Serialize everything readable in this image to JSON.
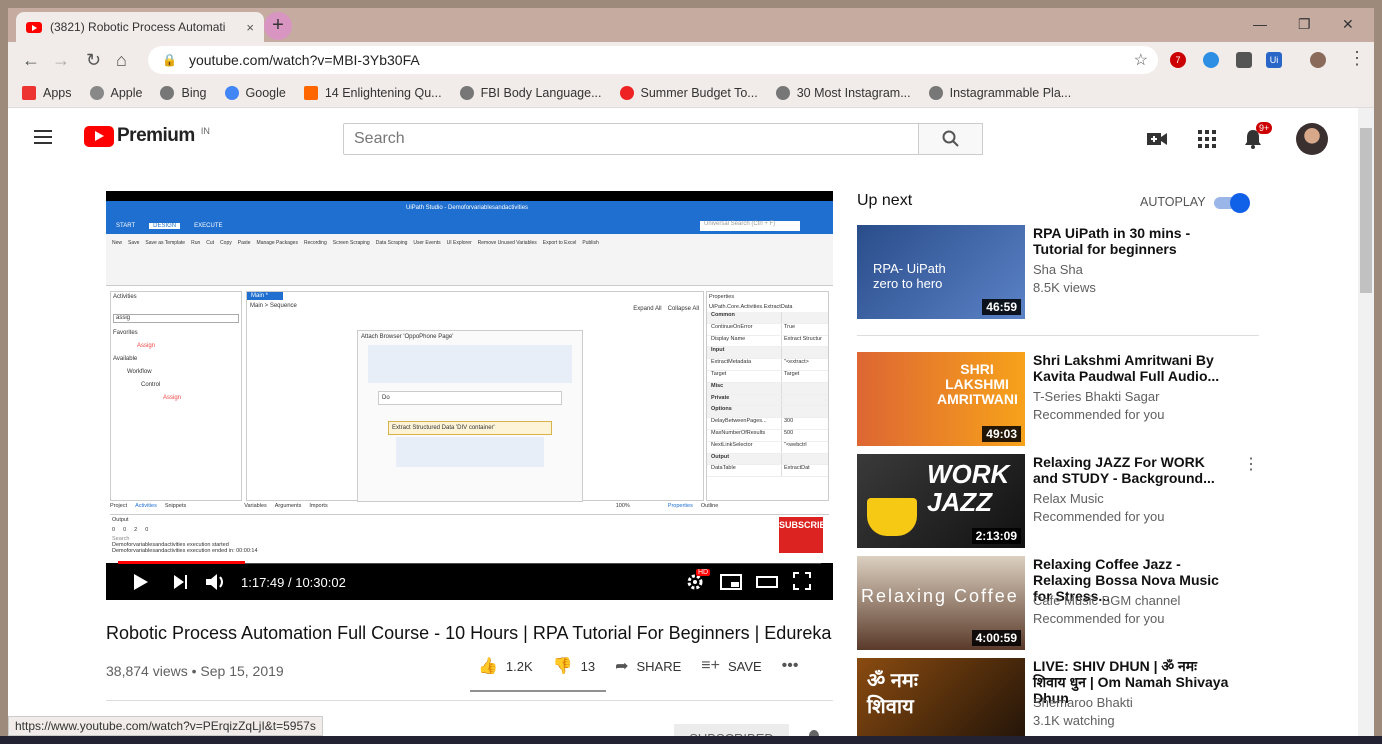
{
  "browser": {
    "tab_title": "(3821) Robotic Process Automati",
    "tab_close": "×",
    "new_tab": "+",
    "url": "youtube.com/watch?v=MBI-3Yb30FA",
    "bookmarks": [
      "Apps",
      "Apple",
      "Bing",
      "Google",
      "14 Enlightening Qu...",
      "FBI Body Language...",
      "Summer Budget To...",
      "30 Most Instagram...",
      "Instagrammable Pla..."
    ],
    "status_url": "https://www.youtube.com/watch?v=PErqizZqLjI&t=5957s",
    "ext_abp_count": "7"
  },
  "youtube": {
    "logo": "Premium",
    "country": "IN",
    "search_placeholder": "Search",
    "notification_count": "9+"
  },
  "video": {
    "time": "1:17:49 / 10:30:02",
    "title": "Robotic Process Automation Full Course - 10 Hours | RPA Tutorial For Beginners | Edureka",
    "meta": "38,874 views • Sep 15, 2019",
    "likes": "1.2K",
    "dislikes": "13",
    "share": "SHARE",
    "save": "SAVE",
    "subscribe": "SUBSCRIBED",
    "progress_fraction": 0.18,
    "studio": {
      "title": "UiPath Studio - Demoforvariablesandactivities",
      "tabs": [
        "START",
        "DESIGN",
        "EXECUTE"
      ],
      "search": "Universal Search (Ctrl + F)",
      "ribbon": [
        "New",
        "Save",
        "Save as Template",
        "Run",
        "Cut",
        "Copy",
        "Paste",
        "Manage Packages",
        "Recording",
        "Screen Scraping",
        "Data Scraping",
        "User Events",
        "UI Explorer",
        "Remove Unused Variables",
        "Export to Excel",
        "Publish"
      ],
      "activities_panel": "Activities",
      "activities_search": "assig",
      "tree": [
        "Favorites",
        "Assign",
        "Available",
        "Workflow",
        "Control",
        "Assign"
      ],
      "main_tab": "Main *",
      "breadcrumb": "Main > Sequence",
      "expand": "Expand All",
      "collapse": "Collapse All",
      "attach": "Attach Browser 'OppoPhone Page'",
      "do": "Do",
      "extract": "Extract Structured Data 'DIV  container'",
      "properties_title": "Properties",
      "properties_class": "UiPath.Core.Activities.ExtractData",
      "props": [
        {
          "k": "Common",
          "v": ""
        },
        {
          "k": "ContinueOnError",
          "v": "True"
        },
        {
          "k": "Display Name",
          "v": "Extract Structur"
        },
        {
          "k": "Input",
          "v": ""
        },
        {
          "k": "ExtractMetadata",
          "v": "\"<extract>"
        },
        {
          "k": "Target",
          "v": "Target"
        },
        {
          "k": "Misc",
          "v": ""
        },
        {
          "k": "Private",
          "v": ""
        },
        {
          "k": "Options",
          "v": ""
        },
        {
          "k": "DelayBetweenPages...",
          "v": "300"
        },
        {
          "k": "MaxNumberOfResults",
          "v": "500"
        },
        {
          "k": "NextLinkSelector",
          "v": "\"<webctrl"
        },
        {
          "k": "Output",
          "v": ""
        },
        {
          "k": "DataTable",
          "v": "ExtractDat"
        }
      ],
      "bottom_tabs": [
        "Project",
        "Activities",
        "Snippets"
      ],
      "center_tabs": [
        "Variables",
        "Arguments",
        "Imports"
      ],
      "zoom": "100%",
      "right_tabs": [
        "Properties",
        "Outline"
      ],
      "output": "Output",
      "output_counts": [
        "0",
        "0",
        "2",
        "0"
      ],
      "log1": "Demoforvariablesandactivities execution started",
      "log2": "Demoforvariablesandactivities execution ended in: 00:00:14",
      "search_label": "Search",
      "subscribe_badge": "SUBSCRIBE"
    }
  },
  "sidebar": {
    "upnext": "Up next",
    "autoplay": "AUTOPLAY",
    "recs": [
      {
        "title": "RPA UiPath in 30 mins - Tutorial for beginners",
        "channel": "Sha Sha",
        "views": "8.5K views",
        "duration": "46:59",
        "thumb_text": "RPA- UiPath zero to hero"
      },
      {
        "title": "Shri Lakshmi Amritwani By Kavita Paudwal Full Audio...",
        "channel": "T-Series Bhakti Sagar",
        "views": "Recommended for you",
        "duration": "49:03",
        "thumb_text": "SHRI LAKSHMI AMRITWANI"
      },
      {
        "title": "Relaxing JAZZ For WORK and STUDY - Background...",
        "channel": "Relax Music",
        "views": "Recommended for you",
        "duration": "2:13:09",
        "thumb_text": "WORK JAZZ"
      },
      {
        "title": "Relaxing Coffee Jazz - Relaxing Bossa Nova Music for Stress...",
        "channel": "Cafe Music BGM channel",
        "views": "Recommended for you",
        "duration": "4:00:59",
        "thumb_text": "Relaxing Coffee"
      },
      {
        "title": "LIVE: SHIV DHUN | ॐ नमः शिवाय धुन | Om Namah Shivaya Dhun",
        "channel": "Shemaroo Bhakti",
        "views": "3.1K watching",
        "duration": "",
        "thumb_text": "ॐ नमः शिवाय"
      }
    ]
  }
}
